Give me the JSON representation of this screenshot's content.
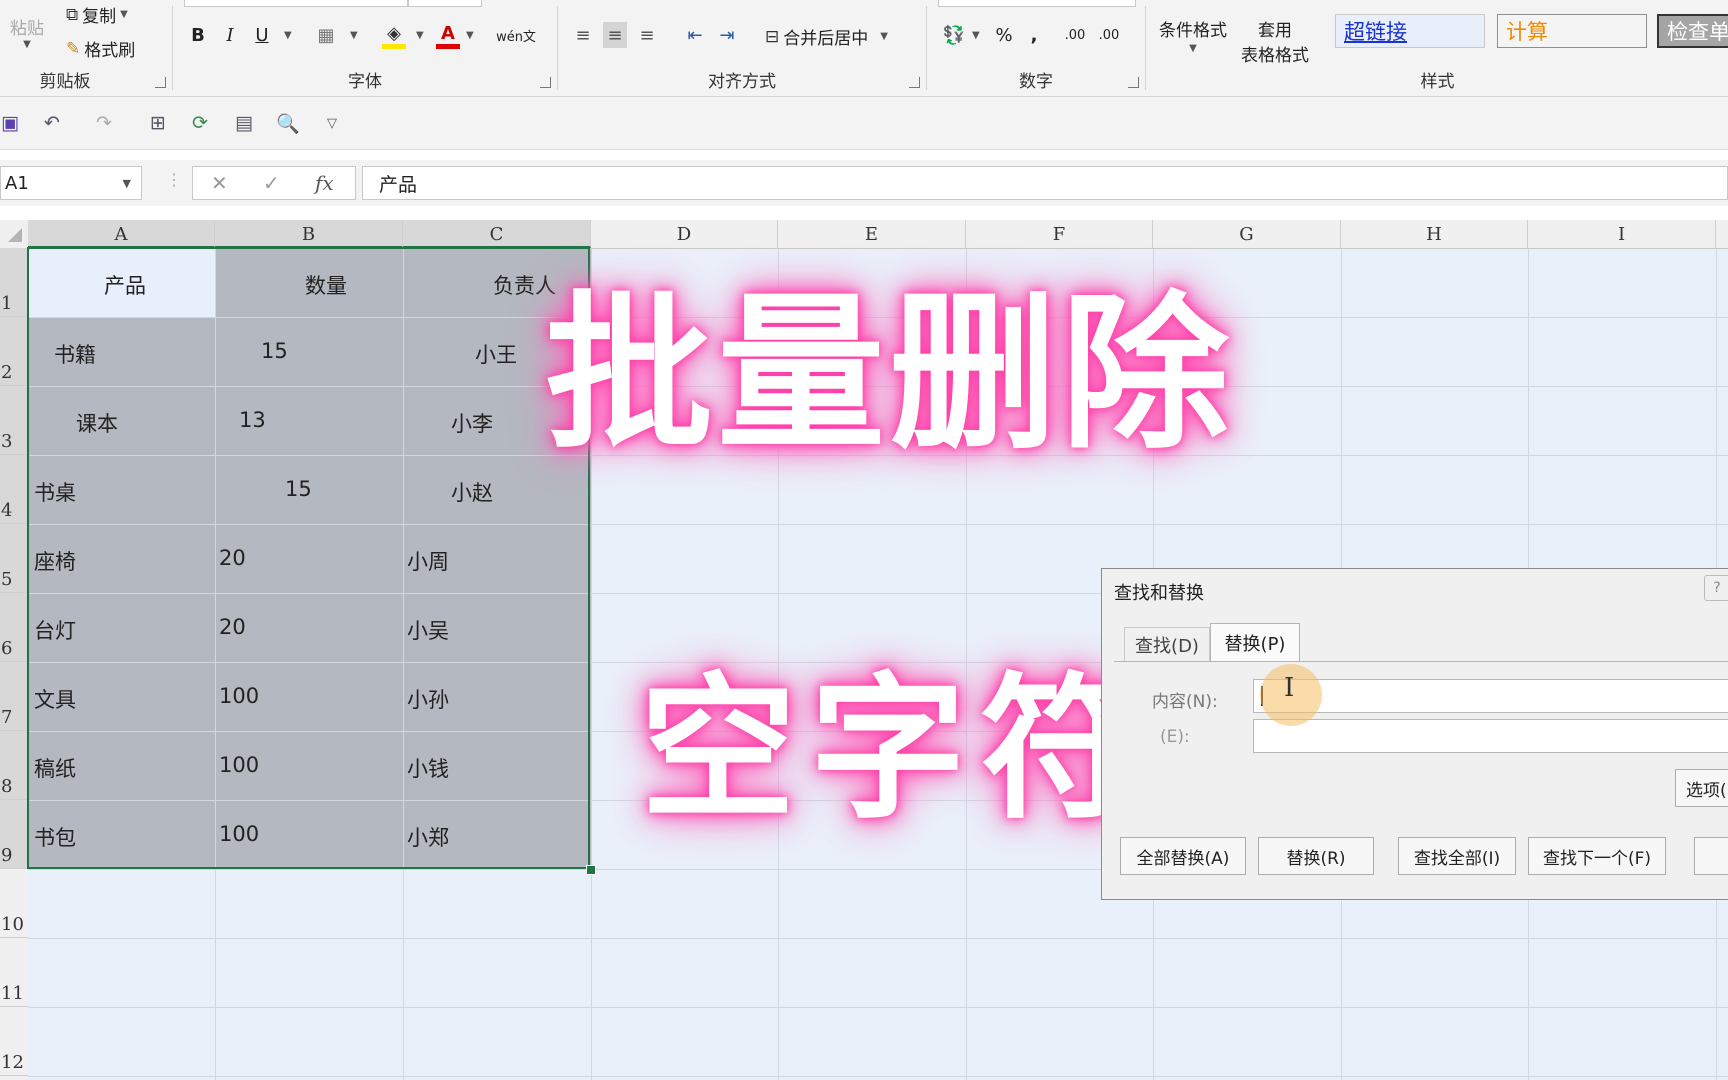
{
  "ribbon": {
    "clipboard": {
      "paste": "粘贴",
      "copy": "复制",
      "format_painter": "格式刷",
      "label": "剪贴板"
    },
    "font": {
      "bold": "B",
      "italic": "I",
      "underline": "U",
      "phonetic": "wén文",
      "label": "字体"
    },
    "alignment": {
      "merge_center": "合并后居中",
      "label": "对齐方式"
    },
    "number": {
      "percent": "%",
      "comma": ",",
      "inc_decimal": ".00",
      "dec_decimal": ".00",
      "label": "数字"
    },
    "styles": {
      "conditional_format": "条件格式",
      "table_format_line1": "套用",
      "table_format_line2": "表格格式",
      "hyperlink": "超链接",
      "calc": "计算",
      "check": "检查单",
      "label": "样式"
    }
  },
  "formula_bar": {
    "name_box": "A1",
    "fx": "fx",
    "content": "产品"
  },
  "grid": {
    "columns": [
      "A",
      "B",
      "C",
      "D",
      "E",
      "F",
      "G",
      "H",
      "I"
    ],
    "rows": [
      "1",
      "2",
      "3",
      "4",
      "5",
      "6",
      "7",
      "8",
      "9",
      "10",
      "11",
      "12"
    ],
    "cells": [
      [
        "产品",
        "数量",
        "负责人"
      ],
      [
        "书籍",
        "15",
        "小王"
      ],
      [
        "课本",
        "13",
        "小李"
      ],
      [
        "书桌",
        "15",
        "小赵"
      ],
      [
        "座椅",
        "20",
        "小周"
      ],
      [
        "台灯",
        "20",
        "小吴"
      ],
      [
        "文具",
        "100",
        "小孙"
      ],
      [
        "稿纸",
        "100",
        "小钱"
      ],
      [
        "书包",
        "100",
        "小郑"
      ]
    ]
  },
  "overlay": {
    "title1": "批量删除",
    "title2": "空字符"
  },
  "dialog": {
    "title": "查找和替换",
    "tab_find": "查找(D)",
    "tab_replace": "替换(P)",
    "find_label": "内容(N):",
    "replace_label": "(E):",
    "find_value": "",
    "replace_value": "",
    "options": "选项(",
    "replace_all": "全部替换(A)",
    "replace": "替换(R)",
    "find_all": "查找全部(I)",
    "find_next": "查找下一个(F)"
  }
}
